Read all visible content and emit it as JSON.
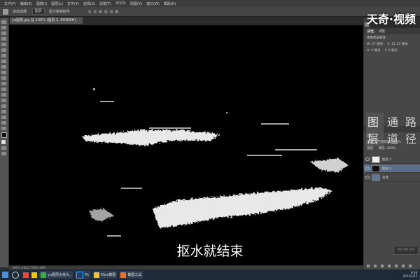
{
  "menu": [
    "文件(F)",
    "编辑(E)",
    "图像(I)",
    "图层(L)",
    "文字(Y)",
    "选择(S)",
    "滤镜(T)",
    "3D(D)",
    "视图(V)",
    "窗口(W)",
    "帮助(H)"
  ],
  "options_bar": {
    "checkbox_label": "自动选择:",
    "dropdown_value": "图层",
    "show_transform": "显示变换控件"
  },
  "document_tab": "yu图层.jpg @ 100% (图层 2, RGB/8#)",
  "status_bar": "100%   文档:2.75M/4.40M",
  "watermark": "天奇·视频",
  "subtitle": "抠水就结束",
  "timer": "00:00:43",
  "properties": {
    "tabs": [
      "属性",
      "调整"
    ],
    "header": "像素图层属性",
    "rows": [
      [
        "W: 47 厘米",
        "X: 11.13 厘米"
      ],
      [
        "H: 0 厘米",
        "Y: 0 厘米"
      ]
    ]
  },
  "layers_panel": {
    "tabs": [
      "图层",
      "通道",
      "路径"
    ],
    "kind_filter": "类型",
    "blend_mode": "正常",
    "opacity": "不透明度: 100%",
    "lock_label": "锁定:",
    "fill": "填充: 100%",
    "layers": [
      {
        "name": "图层 2",
        "selected": false
      },
      {
        "name": "图层 1",
        "selected": true
      },
      {
        "name": "背景",
        "selected": false
      }
    ]
  },
  "taskbar": {
    "items": [
      "yu图层水效大..",
      "Ps",
      "Filpe截图",
      "截图工具"
    ],
    "clock_time": "9:56",
    "clock_date": "2021/1/12"
  }
}
